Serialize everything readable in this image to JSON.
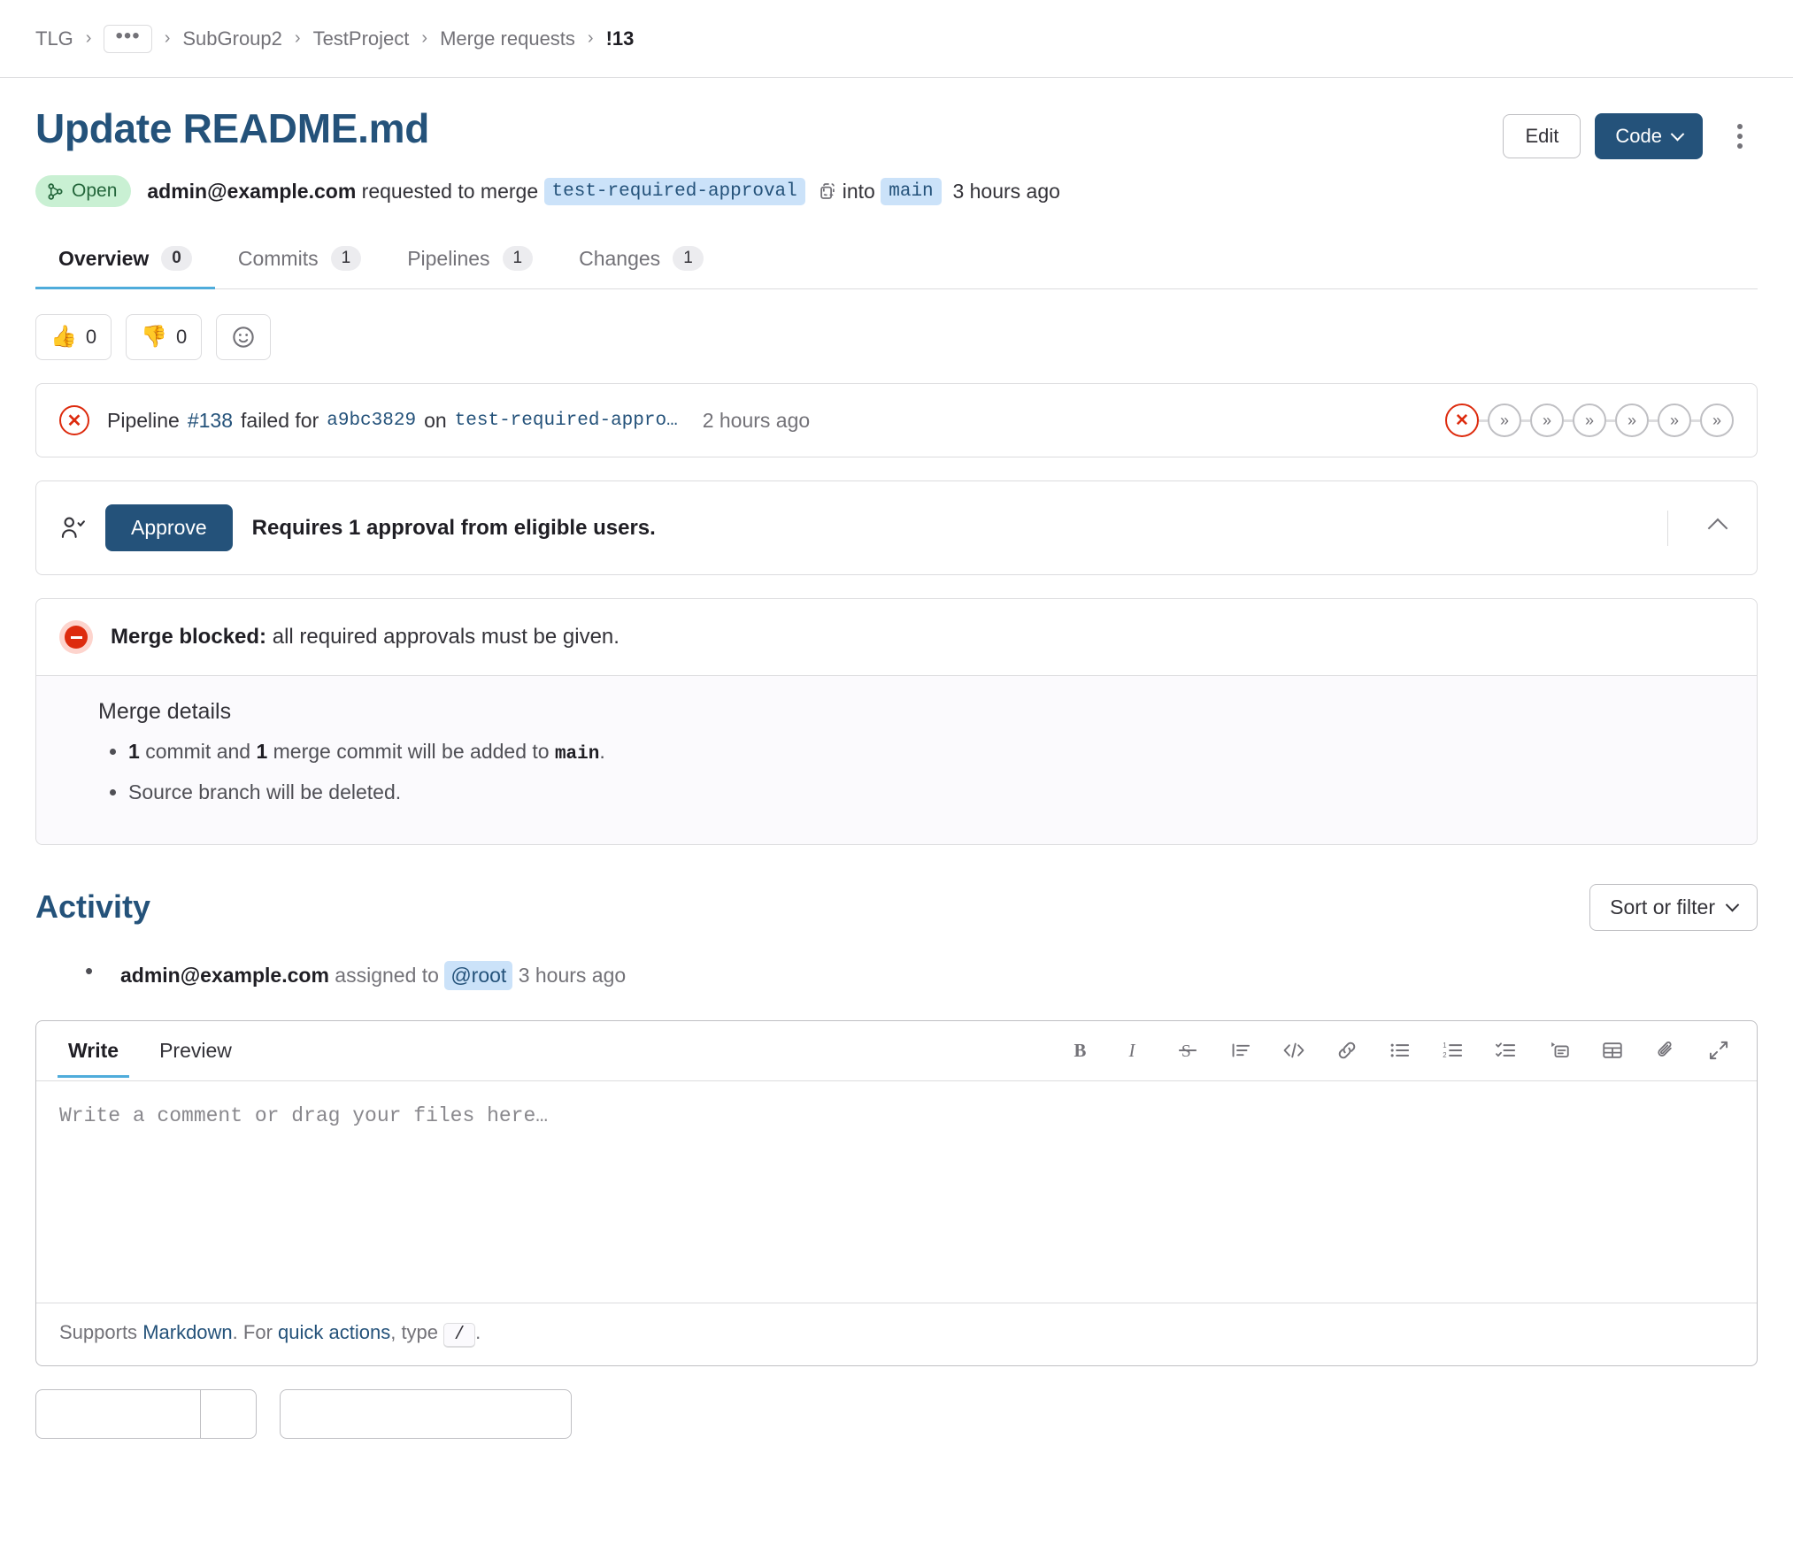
{
  "breadcrumb": {
    "items": [
      {
        "label": "TLG",
        "type": "link"
      },
      {
        "label": "•••",
        "type": "ellipsis"
      },
      {
        "label": "SubGroup2",
        "type": "link"
      },
      {
        "label": "TestProject",
        "type": "link"
      },
      {
        "label": "Merge requests",
        "type": "link"
      },
      {
        "label": "!13",
        "type": "current"
      }
    ],
    "separator": "›"
  },
  "header": {
    "title": "Update README.md",
    "edit_label": "Edit",
    "code_label": "Code",
    "more_actions_label": "More actions"
  },
  "status": {
    "badge": "Open",
    "author": "admin@example.com",
    "action_text": "requested to merge",
    "source_branch": "test-required-approval",
    "into_text": "into",
    "target_branch": "main",
    "time": "3 hours ago"
  },
  "tabs": [
    {
      "label": "Overview",
      "count": "0",
      "active": true
    },
    {
      "label": "Commits",
      "count": "1",
      "active": false
    },
    {
      "label": "Pipelines",
      "count": "1",
      "active": false
    },
    {
      "label": "Changes",
      "count": "1",
      "active": false
    }
  ],
  "reactions": [
    {
      "name": "thumbsup",
      "emoji": "👍",
      "count": "0"
    },
    {
      "name": "thumbsdown",
      "emoji": "👎",
      "count": "0"
    }
  ],
  "pipeline": {
    "status": "failed",
    "prefix": "Pipeline",
    "id": "#138",
    "verb": "failed for",
    "commit_sha": "a9bc3829",
    "on_text": "on",
    "branch": "test-required-appro…",
    "time": "2 hours ago",
    "stages": [
      {
        "status": "failed",
        "glyph": "✕"
      },
      {
        "status": "skipped",
        "glyph": "»"
      },
      {
        "status": "skipped",
        "glyph": "»"
      },
      {
        "status": "skipped",
        "glyph": "»"
      },
      {
        "status": "skipped",
        "glyph": "»"
      },
      {
        "status": "skipped",
        "glyph": "»"
      },
      {
        "status": "skipped",
        "glyph": "»"
      }
    ]
  },
  "approvals": {
    "approve_label": "Approve",
    "requirement_text": "Requires 1 approval from eligible users."
  },
  "merge_status": {
    "blocked_label": "Merge blocked:",
    "blocked_reason": "all required approvals must be given.",
    "details_title": "Merge details",
    "details": [
      {
        "count_commits": "1",
        "mid_text": "commit and",
        "count_merge_commits": "1",
        "tail_text": "merge commit will be added to",
        "branch": "main",
        "period": "."
      },
      {
        "plain": "Source branch will be deleted."
      }
    ]
  },
  "activity": {
    "title": "Activity",
    "sort_filter_label": "Sort or filter",
    "items": [
      {
        "author": "admin@example.com",
        "action": "assigned to",
        "mention": "@root",
        "time": "3 hours ago"
      }
    ]
  },
  "editor": {
    "write_tab": "Write",
    "preview_tab": "Preview",
    "placeholder": "Write a comment or drag your files here…",
    "value": "",
    "toolbar": [
      {
        "name": "bold-icon",
        "label": "Bold"
      },
      {
        "name": "italic-icon",
        "label": "Italic"
      },
      {
        "name": "strikethrough-icon",
        "label": "Strikethrough"
      },
      {
        "name": "quote-icon",
        "label": "Insert a quote"
      },
      {
        "name": "code-icon",
        "label": "Insert code"
      },
      {
        "name": "link-icon",
        "label": "Insert a link"
      },
      {
        "name": "bullet-list-icon",
        "label": "Add a bullet list"
      },
      {
        "name": "numbered-list-icon",
        "label": "Add a numbered list"
      },
      {
        "name": "task-list-icon",
        "label": "Add a checklist"
      },
      {
        "name": "collapsible-section-icon",
        "label": "Add a collapsible section"
      },
      {
        "name": "table-icon",
        "label": "Add a table"
      },
      {
        "name": "attachment-icon",
        "label": "Attach a file or image"
      },
      {
        "name": "fullscreen-icon",
        "label": "Go full screen"
      }
    ],
    "footer": {
      "supports_text": "Supports",
      "markdown_link": "Markdown",
      "for_text": ". For",
      "quick_actions_link": "quick actions",
      "type_text": ", type",
      "slash_key": "/",
      "period": "."
    }
  },
  "colors": {
    "brand_blue": "#24527a",
    "accent_blue": "#4facdb",
    "link_blue": "#24527a",
    "danger_red": "#dd2b0e",
    "open_green_bg": "#c9f0d3",
    "open_green_fg": "#24663b",
    "chip_blue_bg": "#cbe2f9",
    "border_gray": "#dcdcde",
    "muted_text": "#737278"
  }
}
